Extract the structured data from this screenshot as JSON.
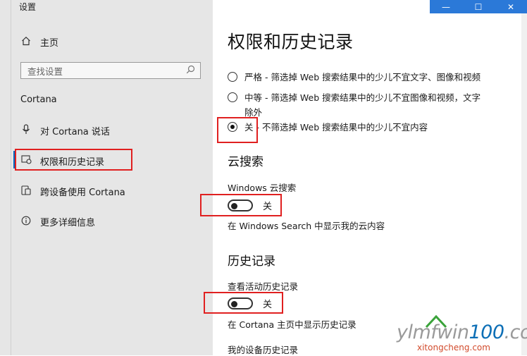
{
  "window": {
    "title": "设置",
    "controls": {
      "minimize": "—",
      "maximize": "☐",
      "close": "✕"
    }
  },
  "sidebar": {
    "home": {
      "icon": "home-icon",
      "label": "主页"
    },
    "search": {
      "placeholder": "查找设置",
      "icon": "search-icon"
    },
    "section": "Cortana",
    "items": [
      {
        "icon": "microphone-icon",
        "label": "对 Cortana 说话"
      },
      {
        "icon": "permissions-icon",
        "label": "权限和历史记录"
      },
      {
        "icon": "devices-icon",
        "label": "跨设备使用 Cortana"
      },
      {
        "icon": "info-icon",
        "label": "更多详细信息"
      }
    ]
  },
  "main": {
    "title": "权限和历史记录",
    "safe_search": {
      "options": [
        {
          "label": "严格 - 筛选掉 Web 搜索结果中的少儿不宜文字、图像和视频",
          "selected": false
        },
        {
          "label": "中等 - 筛选掉 Web 搜索结果中的少儿不宜图像和视频，文字",
          "label_cont": "除外",
          "selected": false
        },
        {
          "label": "关 - 不筛选掉 Web 搜索结果中的少儿不宜内容",
          "selected": true
        }
      ]
    },
    "cloud_search": {
      "heading": "云搜索",
      "setting_label": "Windows 云搜索",
      "toggle_state": "关",
      "description": "在 Windows Search 中显示我的云内容"
    },
    "history": {
      "heading": "历史记录",
      "setting_label": "查看活动历史记录",
      "toggle_state": "关",
      "description": "在 Cortana 主页中显示历史记录",
      "next_label": "我的设备历史记录"
    }
  },
  "watermark": {
    "text_prefix": "ylmfwin",
    "text_accent": "100",
    "text_suffix": ".com",
    "url": "xitongcheng.com"
  },
  "colors": {
    "sidebar_bg": "#e6e6e6",
    "accent": "#0067c0",
    "highlight_box": "#e02020",
    "titlebar": "#2b79d8"
  }
}
